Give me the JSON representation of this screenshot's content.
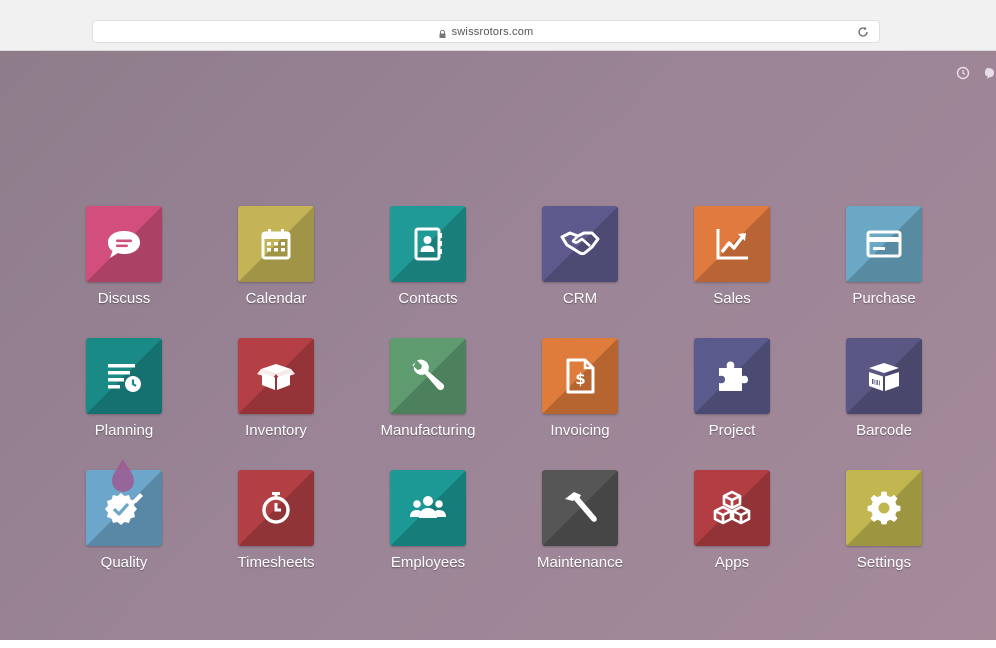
{
  "browser": {
    "url": "swissrotors.com"
  },
  "apps": [
    {
      "label": "Discuss",
      "icon": "speech-bubble-icon",
      "color": "#d24f7d"
    },
    {
      "label": "Calendar",
      "icon": "calendar-icon",
      "color": "#c4b457"
    },
    {
      "label": "Contacts",
      "icon": "address-book-icon",
      "color": "#1f9a96"
    },
    {
      "label": "CRM",
      "icon": "handshake-icon",
      "color": "#5e5a8e"
    },
    {
      "label": "Sales",
      "icon": "chart-trend-icon",
      "color": "#e07a3f"
    },
    {
      "label": "Purchase",
      "icon": "credit-card-icon",
      "color": "#6ba8c5"
    },
    {
      "label": "Planning",
      "icon": "planning-list-icon",
      "color": "#1a8a87"
    },
    {
      "label": "Inventory",
      "icon": "open-box-icon",
      "color": "#b43f45"
    },
    {
      "label": "Manufacturing",
      "icon": "wrench-icon",
      "color": "#5e9c70"
    },
    {
      "label": "Invoicing",
      "icon": "invoice-dollar-icon",
      "color": "#df7b3b"
    },
    {
      "label": "Project",
      "icon": "puzzle-icon",
      "color": "#5b5a8c"
    },
    {
      "label": "Barcode",
      "icon": "barcode-box-icon",
      "color": "#5a5784"
    },
    {
      "label": "Quality",
      "icon": "quality-badge-icon",
      "color": "#6ca6cb"
    },
    {
      "label": "Timesheets",
      "icon": "stopwatch-icon",
      "color": "#b13f44"
    },
    {
      "label": "Employees",
      "icon": "people-group-icon",
      "color": "#1c9895"
    },
    {
      "label": "Maintenance",
      "icon": "hammer-icon",
      "color": "#565656"
    },
    {
      "label": "Apps",
      "icon": "cubes-icon",
      "color": "#b23e43"
    },
    {
      "label": "Settings",
      "icon": "gear-icon",
      "color": "#c1b64f"
    }
  ]
}
